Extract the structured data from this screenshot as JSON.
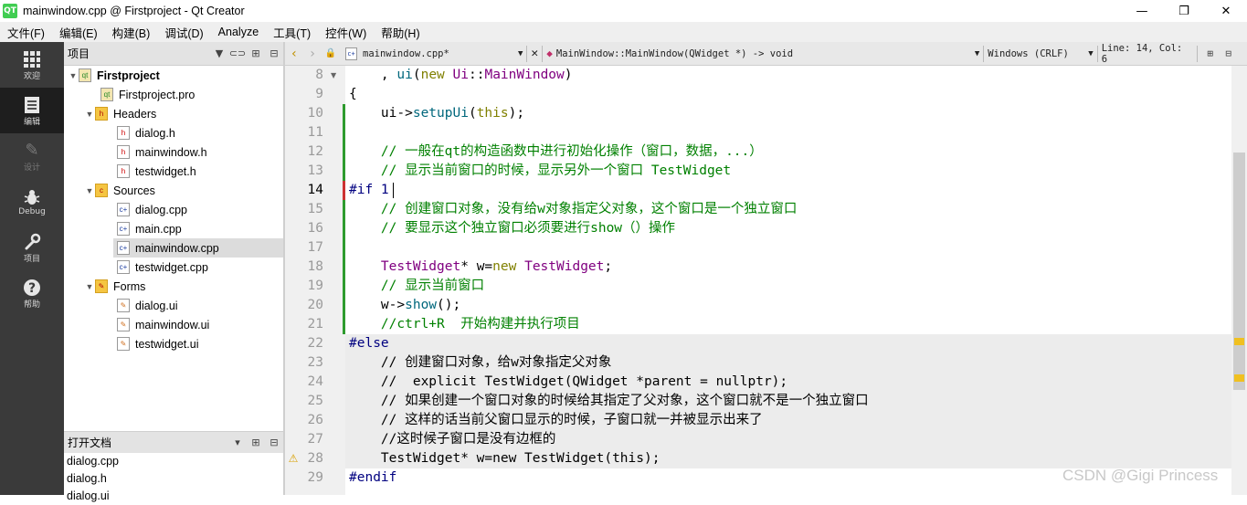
{
  "window": {
    "title": "mainwindow.cpp @ Firstproject - Qt Creator",
    "app_icon": "QT",
    "min": "—",
    "max": "❐",
    "close": "✕"
  },
  "menu": [
    "文件(F)",
    "编辑(E)",
    "构建(B)",
    "调试(D)",
    "Analyze",
    "工具(T)",
    "控件(W)",
    "帮助(H)"
  ],
  "modes": [
    {
      "label": "欢迎",
      "icon": "grid-icon"
    },
    {
      "label": "编辑",
      "icon": "document-icon"
    },
    {
      "label": "设计",
      "icon": "pen-icon"
    },
    {
      "label": "Debug",
      "icon": "bug-icon"
    },
    {
      "label": "项目",
      "icon": "wrench-icon"
    },
    {
      "label": "帮助",
      "icon": "question-icon"
    }
  ],
  "project_panel": {
    "title": "项目"
  },
  "tree": {
    "root": "Firstproject",
    "pro": "Firstproject.pro",
    "headers": "Headers",
    "h1": "dialog.h",
    "h2": "mainwindow.h",
    "h3": "testwidget.h",
    "sources": "Sources",
    "s1": "dialog.cpp",
    "s2": "main.cpp",
    "s3": "mainwindow.cpp",
    "s4": "testwidget.cpp",
    "forms": "Forms",
    "f1": "dialog.ui",
    "f2": "mainwindow.ui",
    "f3": "testwidget.ui"
  },
  "open_docs": {
    "title": "打开文档",
    "items": [
      "dialog.cpp",
      "dialog.h",
      "dialog.ui"
    ]
  },
  "editor": {
    "file": "mainwindow.cpp*",
    "symbol": "MainWindow::MainWindow(QWidget *) -> void",
    "line_endings": "Windows (CRLF)",
    "position": "Line: 14, Col: 6"
  },
  "line_numbers": [
    "8",
    "9",
    "10",
    "11",
    "12",
    "13",
    "14",
    "15",
    "16",
    "17",
    "18",
    "19",
    "20",
    "21",
    "22",
    "23",
    "24",
    "25",
    "26",
    "27",
    "28",
    "29"
  ],
  "code": {
    "l8a": "    , ",
    "l8b": "ui",
    "l8c": "(",
    "l8d": "new",
    "l8e": " ",
    "l8f": "Ui",
    "l8g": "::",
    "l8h": "MainWindow",
    "l8i": ")",
    "l9": "{",
    "l10a": "    ui->",
    "l10b": "setupUi",
    "l10c": "(",
    "l10d": "this",
    "l10e": ");",
    "l11": "",
    "l12": "    // 一般在qt的构造函数中进行初始化操作（窗口，数据，...）",
    "l13": "    // 显示当前窗口的时候，显示另外一个窗口 TestWidget",
    "l14a": "#if ",
    "l14b": "1",
    "l15": "    // 创建窗口对象，没有给w对象指定父对象，这个窗口是一个独立窗口",
    "l16": "    // 要显示这个独立窗口必须要进行show（）操作",
    "l17": "",
    "l18a": "    ",
    "l18b": "TestWidget",
    "l18c": "* w=",
    "l18d": "new",
    "l18e": " ",
    "l18f": "TestWidget",
    "l18g": ";",
    "l19": "    // 显示当前窗口",
    "l20a": "    w->",
    "l20b": "show",
    "l20c": "();",
    "l21": "    //ctrl+R  开始构建并执行项目",
    "l22": "#else",
    "l23": "    // 创建窗口对象，给w对象指定父对象",
    "l24": "    //  explicit TestWidget(QWidget *parent = nullptr);",
    "l25": "    // 如果创建一个窗口对象的时候给其指定了父对象，这个窗口就不是一个独立窗口",
    "l26": "    // 这样的话当前父窗口显示的时候，子窗口就一并被显示出来了",
    "l27": "    //这时候子窗口是没有边框的",
    "l28": "    TestWidget* w=new TestWidget(this);",
    "l29": "#endif"
  },
  "watermark": "CSDN @Gigi Princess"
}
